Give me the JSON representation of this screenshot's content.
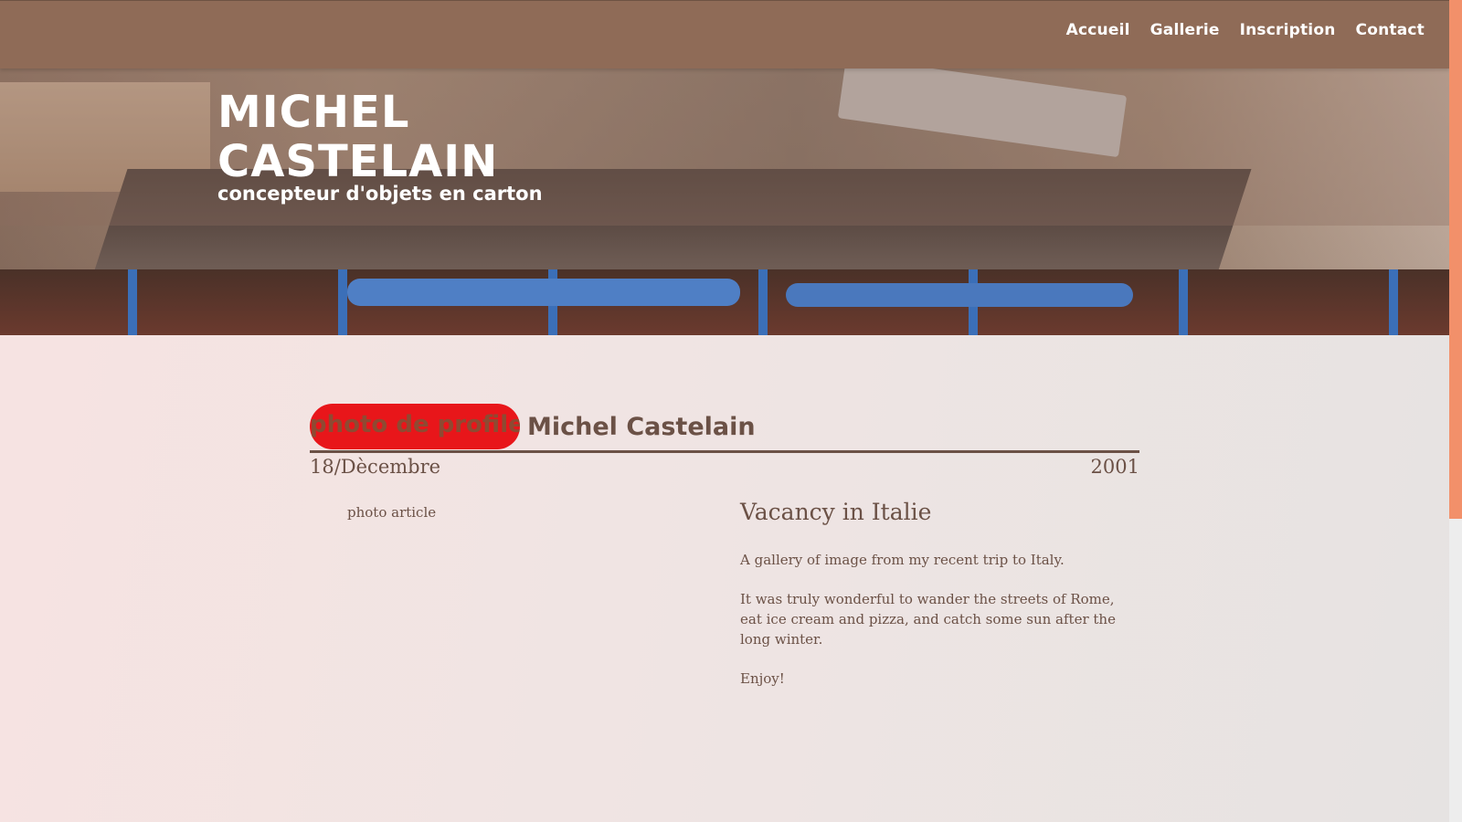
{
  "nav": {
    "items": [
      {
        "label": "Accueil"
      },
      {
        "label": "Gallerie"
      },
      {
        "label": "Inscription"
      },
      {
        "label": "Contact"
      }
    ]
  },
  "hero": {
    "title": "MICHEL CASTELAIN",
    "subtitle": "concepteur d'objets en carton"
  },
  "article": {
    "profile_alt": "photo de profile",
    "author": "Michel Castelain",
    "date_day_month": "18/Dècembre",
    "date_year": "2001",
    "photo_alt": "photo article",
    "title": "Vacancy in Italie",
    "paragraphs": [
      "A gallery of image from my recent trip to Italy.",
      "It was truly wonderful to wander the streets of Rome, eat ice cream and pizza, and catch some sun after the long winter.",
      "Enjoy!"
    ]
  },
  "colors": {
    "header_bg": "#8f6b57",
    "text_brown": "#6b5146",
    "profile_red": "#e8161a",
    "scroll_thumb": "#f2906a"
  }
}
